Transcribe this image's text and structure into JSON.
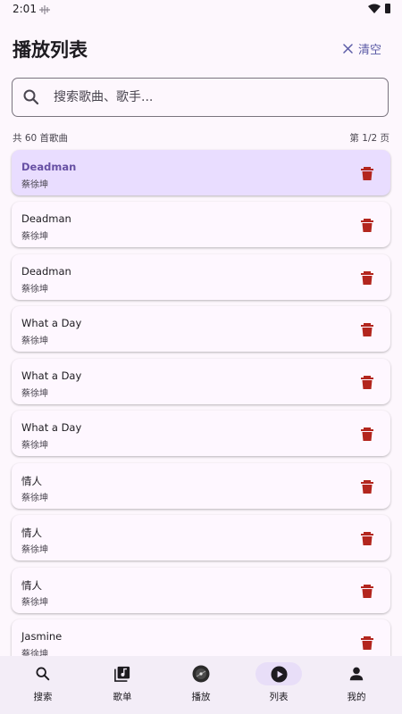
{
  "status": {
    "time": "2:01"
  },
  "header": {
    "title": "播放列表",
    "clear_label": "清空"
  },
  "search": {
    "placeholder": "搜索歌曲、歌手..."
  },
  "summary": {
    "count": "共 60 首歌曲",
    "page": "第 1/2 页"
  },
  "songs": [
    {
      "title": "Deadman",
      "artist": "蔡徐坤",
      "active": true
    },
    {
      "title": "Deadman",
      "artist": "蔡徐坤"
    },
    {
      "title": "Deadman",
      "artist": "蔡徐坤"
    },
    {
      "title": "What a Day",
      "artist": "蔡徐坤"
    },
    {
      "title": "What a Day",
      "artist": "蔡徐坤"
    },
    {
      "title": "What a Day",
      "artist": "蔡徐坤"
    },
    {
      "title": "情人",
      "artist": "蔡徐坤"
    },
    {
      "title": "情人",
      "artist": "蔡徐坤"
    },
    {
      "title": "情人",
      "artist": "蔡徐坤"
    },
    {
      "title": "Jasmine",
      "artist": "蔡徐坤"
    }
  ],
  "nav": [
    {
      "label": "搜索",
      "icon": "search-icon"
    },
    {
      "label": "歌单",
      "icon": "playlist-icon"
    },
    {
      "label": "播放",
      "icon": "album-disc-icon"
    },
    {
      "label": "列表",
      "icon": "play-circle-icon",
      "active": true
    },
    {
      "label": "我的",
      "icon": "person-icon"
    }
  ],
  "colors": {
    "background": "#fdf7fd",
    "accent": "#6750a4",
    "active_card": "#e9ddff",
    "delete": "#b3261e",
    "nav_background": "#f3edf7"
  }
}
